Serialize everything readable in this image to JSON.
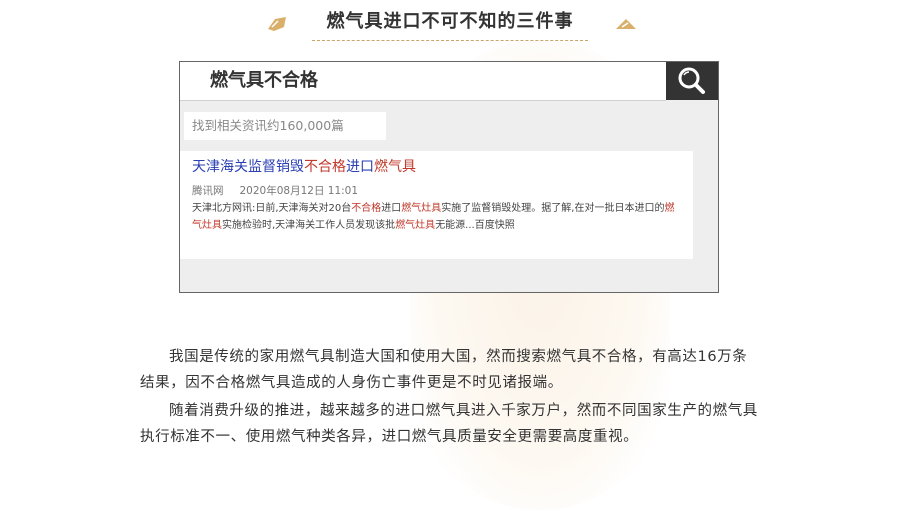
{
  "header": {
    "title": "燃气具进口不可不知的三件事",
    "accent_color": "#d9b06b"
  },
  "search": {
    "query": "燃气具不合格",
    "button_icon": "search-icon",
    "result_count_text": "找到相关资讯约160,000篇"
  },
  "result": {
    "title_part1": "天津海关监督销毁",
    "title_part2": "不合格",
    "title_part3": "进口",
    "title_part4": "燃气具",
    "source": "腾讯网",
    "date": "2020年08月12日 11:01",
    "snippet": {
      "s1": "天津北方网讯:日前,天津海关对20台",
      "s2": "不合格",
      "s3": "进口",
      "s4": "燃气灶具",
      "s5": "实施了监督销毁处理。据了解,在对一批日本进口的",
      "s6": "燃气灶具",
      "s7": "实施检验时,天津海关工作人员发现该批",
      "s8": "燃气灶具",
      "s9": "无能源...百度快照"
    }
  },
  "article": {
    "p1": "我国是传统的家用燃气具制造大国和使用大国，然而搜索燃气具不合格，有高达16万条结果，因不合格燃气具造成的人身伤亡事件更是不时见诸报端。",
    "p2": "随着消费升级的推进，越来越多的进口燃气具进入千家万户，然而不同国家生产的燃气具执行标准不一、使用燃气种类各异，进口燃气具质量安全更需要高度重视。"
  }
}
